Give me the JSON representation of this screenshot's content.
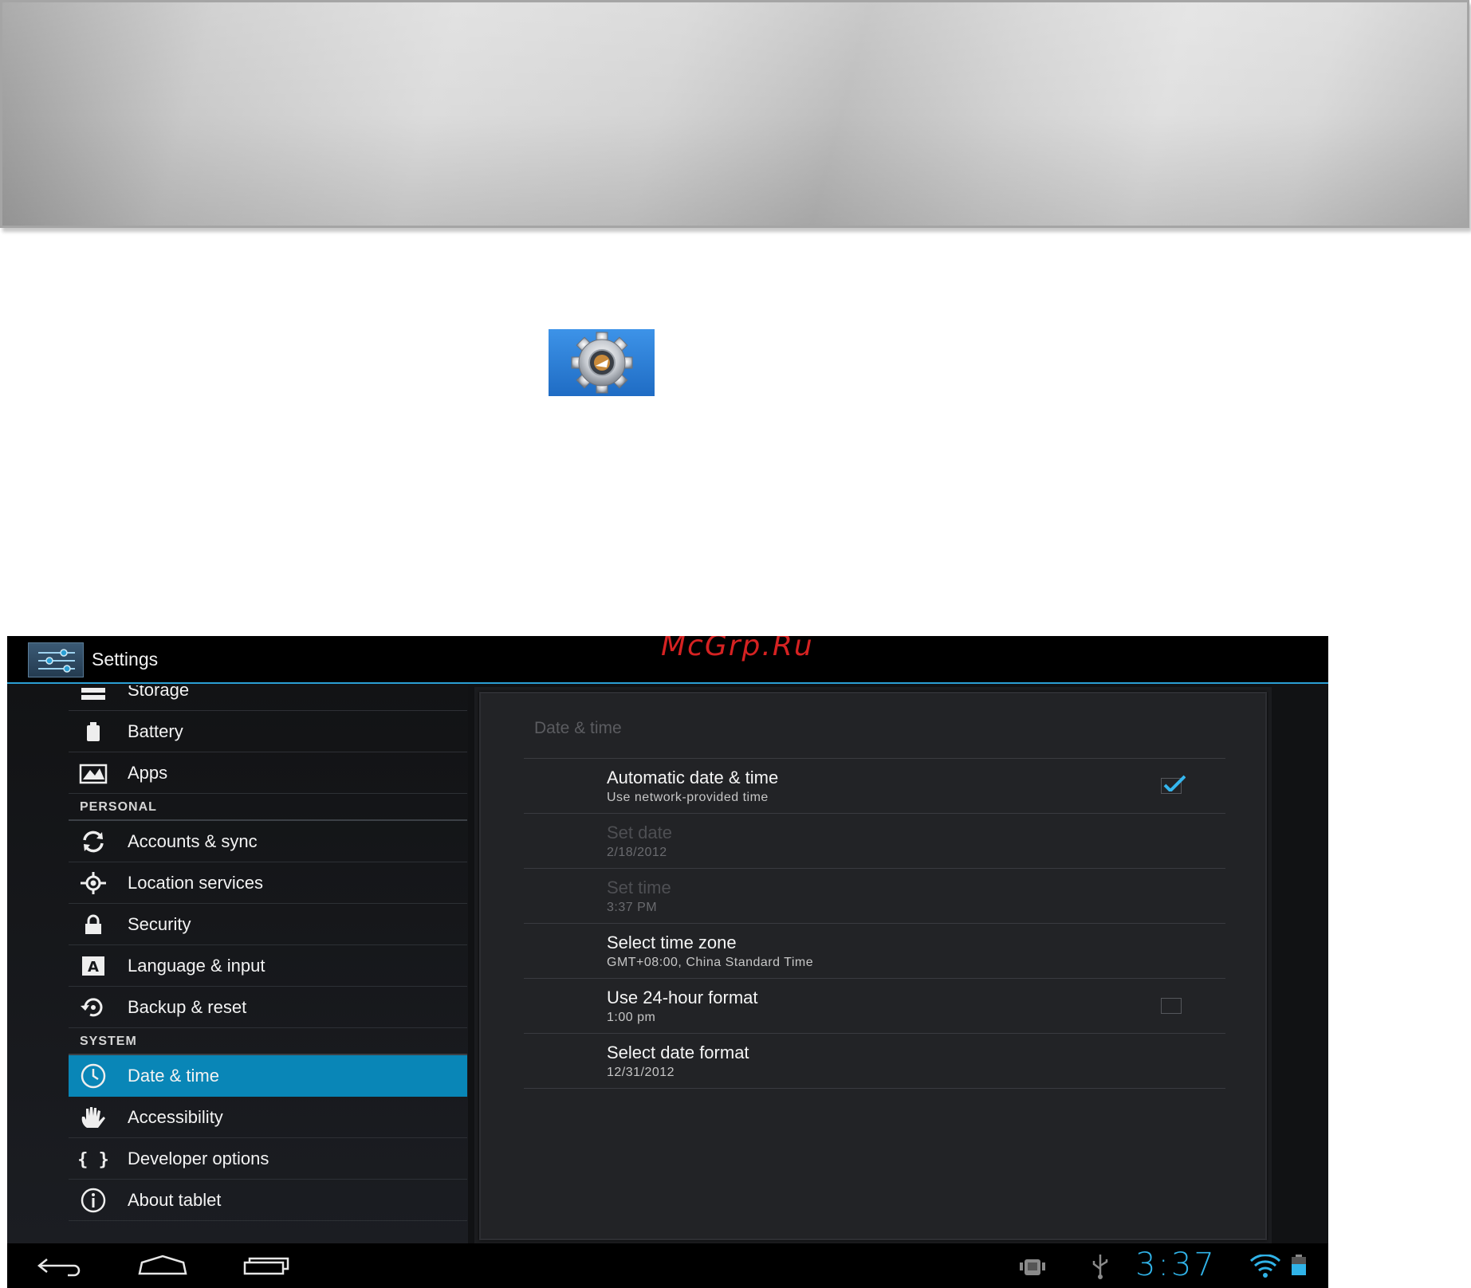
{
  "watermark": "McGrp.Ru",
  "action_bar": {
    "title": "Settings"
  },
  "menu": {
    "items_top": [
      {
        "label": "Storage",
        "icon": "storage-icon"
      },
      {
        "label": "Battery",
        "icon": "battery-icon"
      },
      {
        "label": "Apps",
        "icon": "apps-icon"
      }
    ],
    "personal_header": "PERSONAL",
    "items_personal": [
      {
        "label": "Accounts & sync",
        "icon": "sync-icon"
      },
      {
        "label": "Location services",
        "icon": "location-icon"
      },
      {
        "label": "Security",
        "icon": "lock-icon"
      },
      {
        "label": "Language & input",
        "icon": "language-icon"
      },
      {
        "label": "Backup & reset",
        "icon": "backup-icon"
      }
    ],
    "system_header": "SYSTEM",
    "items_system": [
      {
        "label": "Date & time",
        "icon": "clock-icon",
        "active": true
      },
      {
        "label": "Accessibility",
        "icon": "hand-icon"
      },
      {
        "label": "Developer options",
        "icon": "braces-icon"
      },
      {
        "label": "About tablet",
        "icon": "info-icon"
      }
    ]
  },
  "detail": {
    "title": "Date & time",
    "prefs": [
      {
        "title": "Automatic date & time",
        "summary": "Use network-provided time",
        "checked": true,
        "disabled": false
      },
      {
        "title": "Set date",
        "summary": "2/18/2012",
        "disabled": true
      },
      {
        "title": "Set time",
        "summary": "3:37 PM",
        "disabled": true
      },
      {
        "title": "Select time zone",
        "summary": "GMT+08:00, China Standard Time",
        "disabled": false
      },
      {
        "title": "Use 24-hour format",
        "summary": "1:00 pm",
        "checked": false,
        "disabled": false
      },
      {
        "title": "Select date format",
        "summary": "12/31/2012",
        "disabled": false
      }
    ]
  },
  "status_bar": {
    "time": "3:37"
  },
  "colors": {
    "accent": "#2b9fd4",
    "active_item": "#0986b7",
    "watermark": "#d62222"
  }
}
